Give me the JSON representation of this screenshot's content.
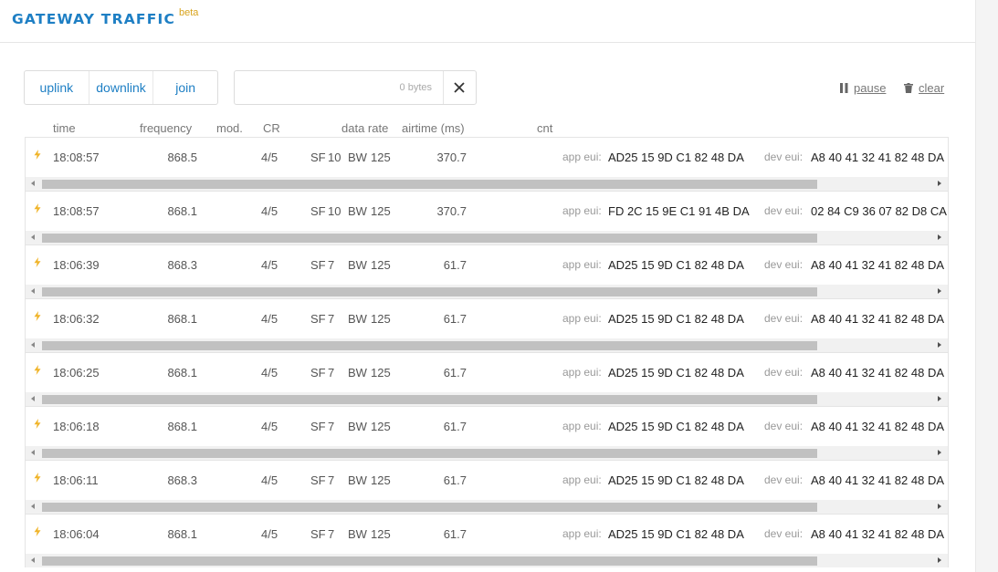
{
  "header": {
    "title": "GATEWAY TRAFFIC",
    "badge": "beta"
  },
  "filters": [
    "uplink",
    "downlink",
    "join"
  ],
  "search": {
    "value": "",
    "bytes": "0 bytes"
  },
  "controls": {
    "pause": "pause",
    "clear": "clear"
  },
  "columns": {
    "time": "time",
    "frequency": "frequency",
    "mod": "mod.",
    "cr": "CR",
    "data_rate": "data rate",
    "airtime": "airtime (ms)",
    "cnt": "cnt"
  },
  "labels": {
    "sf": "SF",
    "bw": "BW",
    "app_eui": "app eui:",
    "dev_eui": "dev eui:"
  },
  "colors": {
    "accent": "#1e7fc4",
    "beta": "#d8a31c",
    "bolt": "#f0b429"
  },
  "rows": [
    {
      "time": "18:08:57",
      "freq": "868.5",
      "cr": "4/5",
      "sf": "10",
      "bw": "125",
      "airtime": "370.7",
      "app_eui": "AD25 15 9D C1 82 48 DA",
      "dev_eui": "A8 40 41 32 41 82 48 DA"
    },
    {
      "time": "18:08:57",
      "freq": "868.1",
      "cr": "4/5",
      "sf": "10",
      "bw": "125",
      "airtime": "370.7",
      "app_eui": "FD 2C 15 9E C1 91 4B DA",
      "dev_eui": "02 84 C9 36 07 82 D8 CA"
    },
    {
      "time": "18:06:39",
      "freq": "868.3",
      "cr": "4/5",
      "sf": "7",
      "bw": "125",
      "airtime": "61.7",
      "app_eui": "AD25 15 9D C1 82 48 DA",
      "dev_eui": "A8 40 41 32 41 82 48 DA"
    },
    {
      "time": "18:06:32",
      "freq": "868.1",
      "cr": "4/5",
      "sf": "7",
      "bw": "125",
      "airtime": "61.7",
      "app_eui": "AD25 15 9D C1 82 48 DA",
      "dev_eui": "A8 40 41 32 41 82 48 DA"
    },
    {
      "time": "18:06:25",
      "freq": "868.1",
      "cr": "4/5",
      "sf": "7",
      "bw": "125",
      "airtime": "61.7",
      "app_eui": "AD25 15 9D C1 82 48 DA",
      "dev_eui": "A8 40 41 32 41 82 48 DA"
    },
    {
      "time": "18:06:18",
      "freq": "868.1",
      "cr": "4/5",
      "sf": "7",
      "bw": "125",
      "airtime": "61.7",
      "app_eui": "AD25 15 9D C1 82 48 DA",
      "dev_eui": "A8 40 41 32 41 82 48 DA"
    },
    {
      "time": "18:06:11",
      "freq": "868.3",
      "cr": "4/5",
      "sf": "7",
      "bw": "125",
      "airtime": "61.7",
      "app_eui": "AD25 15 9D C1 82 48 DA",
      "dev_eui": "A8 40 41 32 41 82 48 DA"
    },
    {
      "time": "18:06:04",
      "freq": "868.1",
      "cr": "4/5",
      "sf": "7",
      "bw": "125",
      "airtime": "61.7",
      "app_eui": "AD25 15 9D C1 82 48 DA",
      "dev_eui": "A8 40 41 32 41 82 48 DA"
    }
  ]
}
